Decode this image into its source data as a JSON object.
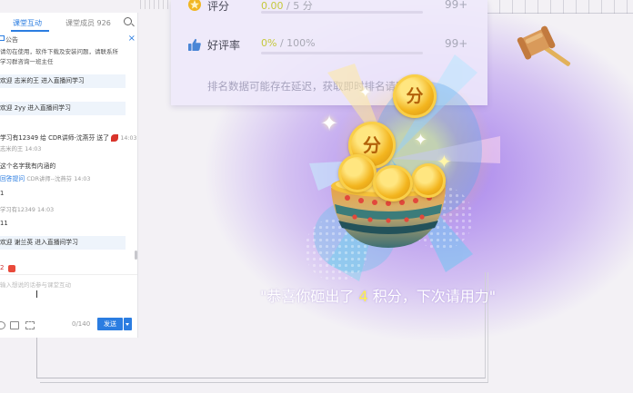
{
  "chat": {
    "tab_interaction": "课堂互动",
    "tab_score": "课堂成员 926",
    "notice_title": "公告",
    "notice_line1": "请勿在使用，软件下载及安装问题，请联系所",
    "notice_line2": "学习群咨询一班主任",
    "messages": [
      {
        "text": "欢迎 志米的王 进入直播间学习"
      },
      {
        "text": "欢迎 2yy 进入直播间学习"
      },
      {
        "text": "学习有12349 给 CDR讲师-沈燕芬 送了",
        "time": "14:03"
      },
      {
        "text": "志米的王",
        "time": "14:03"
      },
      {
        "text": "这个名字我有内涵的"
      },
      {
        "text": "回答提问",
        "text2": "CDR讲师--沈燕芬",
        "time": "14:03"
      },
      {
        "text": "1"
      },
      {
        "text": "学习有12349",
        "time": "14:03"
      },
      {
        "text": "11"
      },
      {
        "text": "欢迎 谢兰英 进入直播间学习"
      }
    ],
    "emoji_count": "2",
    "input_placeholder": "输入想说的话参与课堂互动",
    "counter": "0/140",
    "send_label": "发送"
  },
  "ranking": {
    "row1_label": "评分",
    "row1_score_value": "0.00",
    "row1_score_max": "/ 5 分",
    "row1_rank": "99+",
    "row2_label": "好评率",
    "row2_score_value": "0%",
    "row2_score_max": "/ 100%",
    "row2_rank": "99+",
    "note": "排名数据可能存在延迟，获取即时排名请刷新"
  },
  "reward": {
    "coin_char": "分",
    "result_prefix": "\"恭喜你砸出了 ",
    "result_number": "4",
    "result_suffix": " 积分，下次请用力\""
  },
  "colors": {
    "accent_blue": "#2b7de1",
    "purple_glow": "#a078eb",
    "gold": "#f3b51e",
    "highlight_yellow": "#fff24a"
  }
}
